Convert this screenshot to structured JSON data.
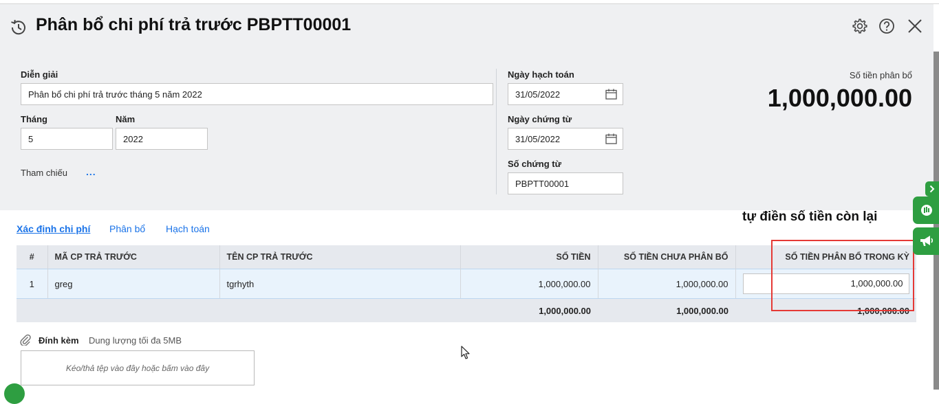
{
  "window": {
    "title": "Phân bổ chi phí trả trước PBPTT00001",
    "icons": [
      "history-icon",
      "gear-icon",
      "help-icon",
      "close-icon"
    ]
  },
  "form": {
    "description_label": "Diễn giải",
    "description_value": "Phân bổ chi phí trả trước tháng 5 năm 2022",
    "month_label": "Tháng",
    "month_value": "5",
    "year_label": "Năm",
    "year_value": "2022",
    "reference_label": "Tham chiếu",
    "reference_dots": "...",
    "posting_date_label": "Ngày hạch toán",
    "posting_date_value": "31/05/2022",
    "voucher_date_label": "Ngày chứng từ",
    "voucher_date_value": "31/05/2022",
    "voucher_no_label": "Số chứng từ",
    "voucher_no_value": "PBPTT00001"
  },
  "summary": {
    "amount_label": "Số tiền phân bổ",
    "amount_value": "1,000,000.00"
  },
  "annotation": "tự điền số tiền còn lại",
  "tabs": [
    {
      "label": "Xác định chi phí",
      "active": true
    },
    {
      "label": "Phân bổ",
      "active": false
    },
    {
      "label": "Hạch toán",
      "active": false
    }
  ],
  "table": {
    "columns": [
      "#",
      "MÃ CP TRẢ TRƯỚC",
      "TÊN CP TRẢ TRƯỚC",
      "SỐ TIỀN",
      "SỐ TIỀN CHƯA PHÂN BỔ",
      "SỐ TIỀN PHÂN BỔ TRONG KỲ"
    ],
    "rows": [
      {
        "index": "1",
        "code": "greg",
        "name": "tgrhyth",
        "amount": "1,000,000.00",
        "unallocated": "1,000,000.00",
        "allocated": "1,000,000.00"
      }
    ],
    "totals": {
      "amount": "1,000,000.00",
      "unallocated": "1,000,000.00",
      "allocated": "1,000,000.00"
    }
  },
  "attachment": {
    "label": "Đính kèm",
    "hint": "Dung lượng tối đa 5MB",
    "drop_text": "Kéo/thả tệp vào đây hoặc bấm vào đây"
  },
  "colors": {
    "header_bg": "#eff0f2",
    "link": "#1a73e8",
    "highlight_box": "#e53935",
    "side_green": "#2e9e41"
  }
}
